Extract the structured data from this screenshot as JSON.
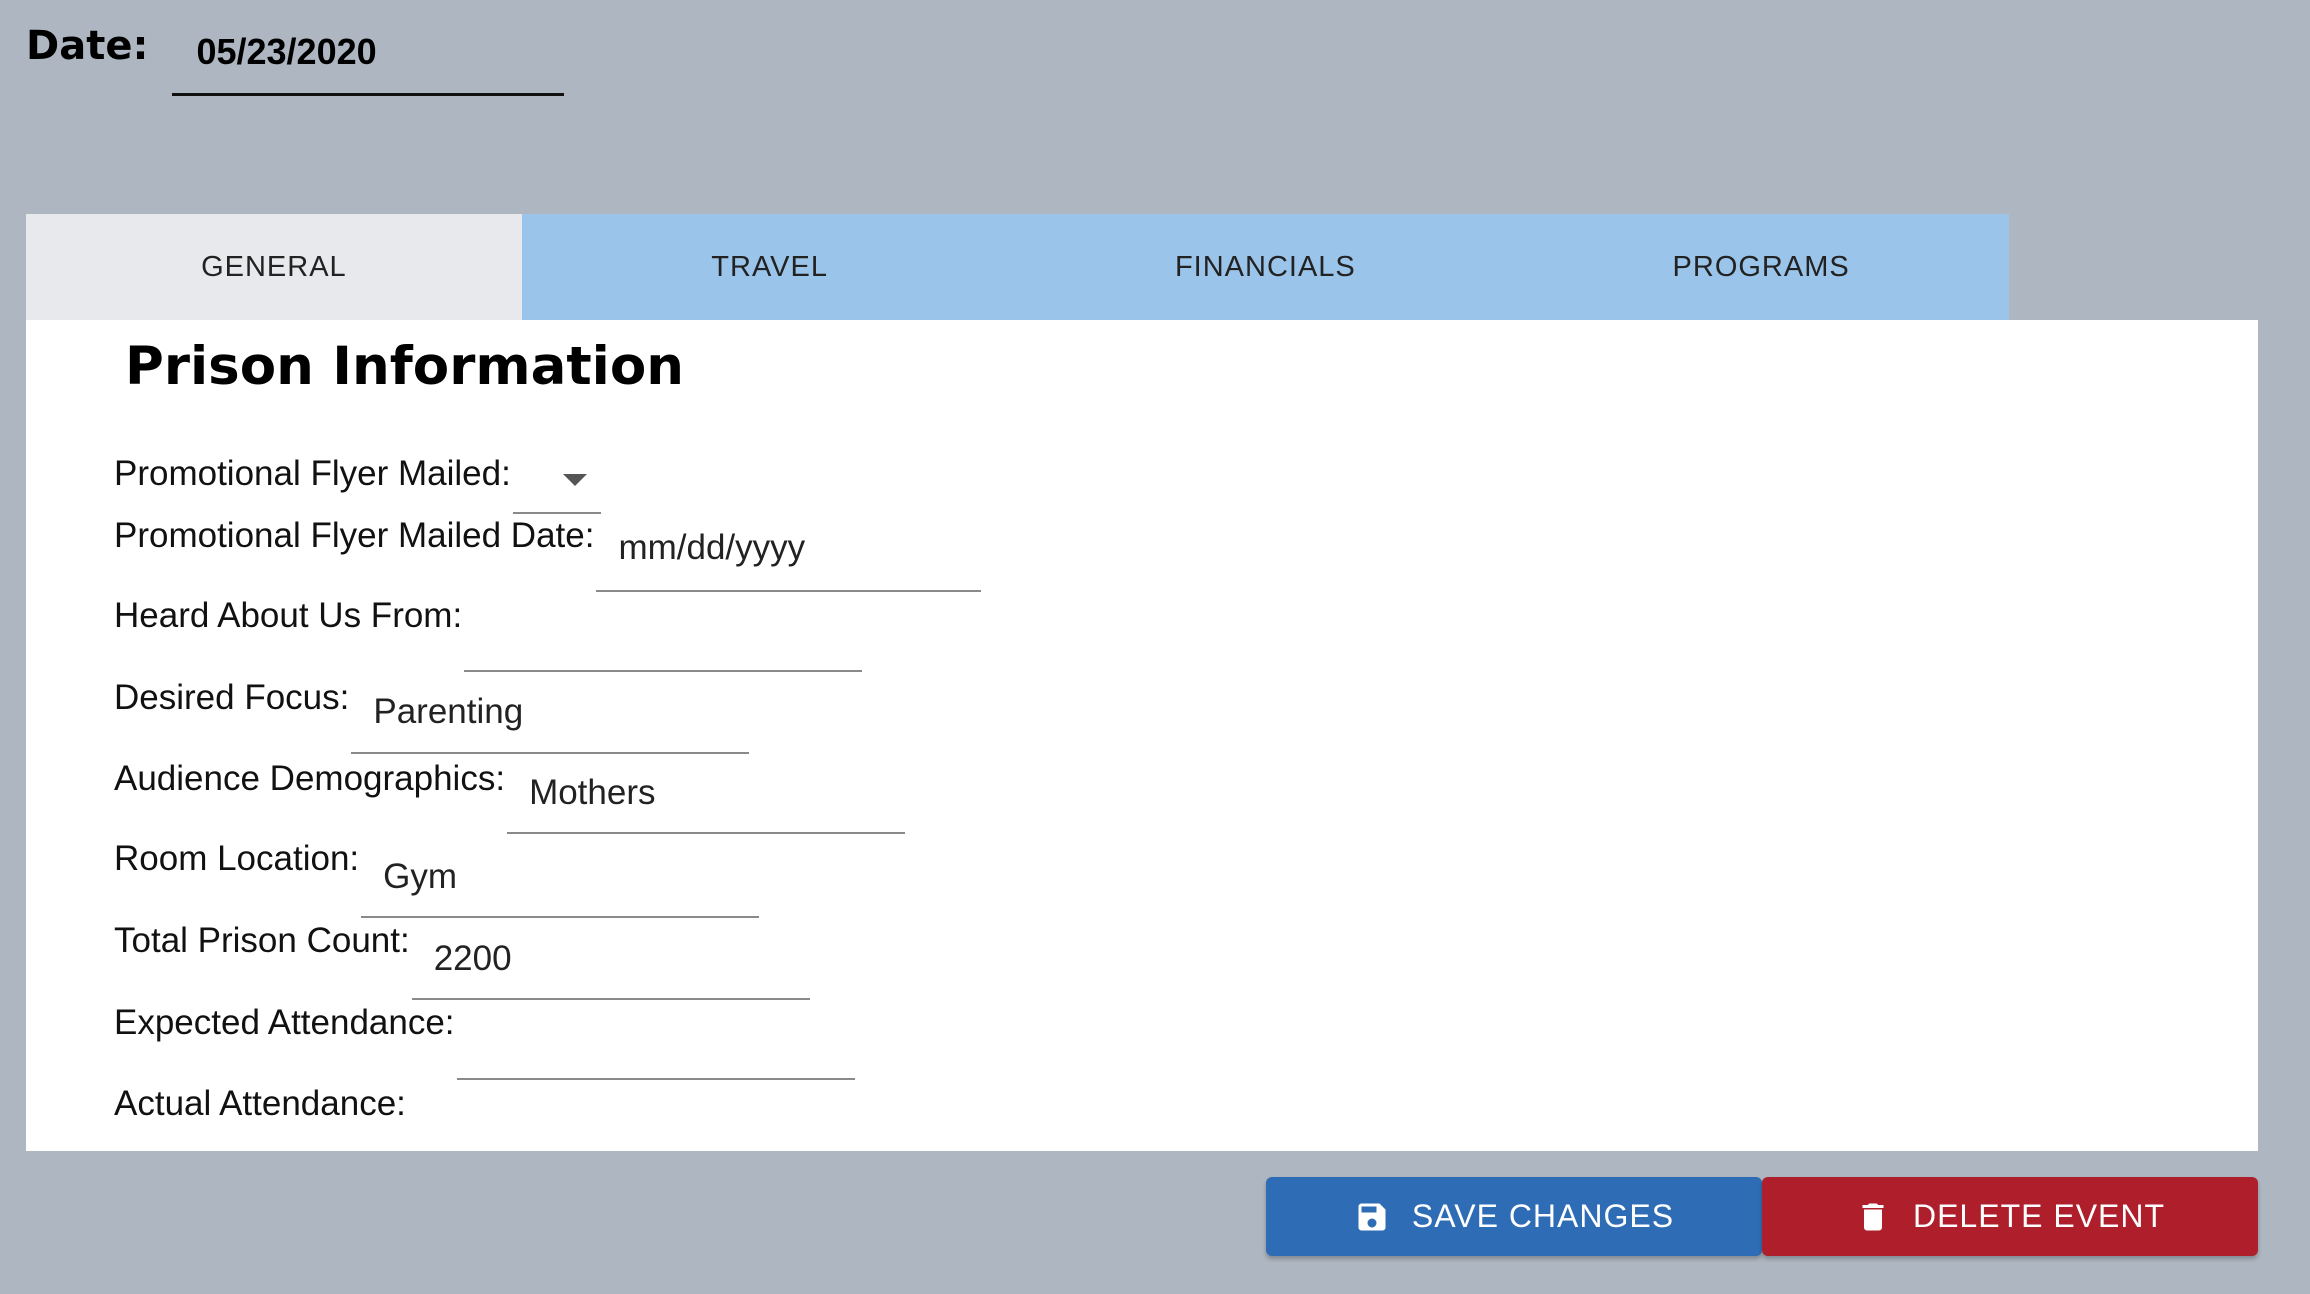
{
  "header": {
    "date_label": "Date:",
    "date_value": "05/23/2020"
  },
  "tabs": [
    {
      "label": "GENERAL",
      "active": true
    },
    {
      "label": "TRAVEL",
      "active": false
    },
    {
      "label": "FINANCIALS",
      "active": false
    },
    {
      "label": "PROGRAMS",
      "active": false
    }
  ],
  "section": {
    "title": "Prison Information"
  },
  "form": {
    "promo_flyer_mailed": {
      "label": "Promotional Flyer Mailed:",
      "value": ""
    },
    "promo_flyer_mailed_date": {
      "label": "Promotional Flyer Mailed Date:",
      "placeholder": "mm/dd/yyyy"
    },
    "heard_about_us": {
      "label": "Heard About Us From:",
      "value": ""
    },
    "desired_focus": {
      "label": "Desired Focus:",
      "value": "Parenting"
    },
    "audience_demographics": {
      "label": "Audience Demographics:",
      "value": "Mothers"
    },
    "room_location": {
      "label": "Room Location:",
      "value": "Gym"
    },
    "total_prison_count": {
      "label": "Total Prison Count:",
      "value": "2200"
    },
    "expected_attendance": {
      "label": "Expected Attendance:",
      "value": ""
    },
    "actual_attendance": {
      "label": "Actual Attendance:",
      "value": ""
    }
  },
  "actions": {
    "save_label": "SAVE CHANGES",
    "delete_label": "DELETE EVENT",
    "save_icon": "floppy-disk-icon",
    "delete_icon": "trash-icon"
  },
  "colors": {
    "background": "#aeb6c1",
    "tab_bar": "#9ac4e9",
    "tab_active": "#e8e9ec",
    "save_button": "#2e6db5",
    "delete_button": "#ae1f2b"
  }
}
